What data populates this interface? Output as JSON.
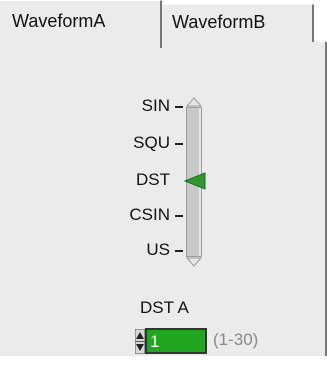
{
  "tabs": [
    {
      "label": "WaveformA",
      "active": true
    },
    {
      "label": "WaveformB",
      "active": false
    }
  ],
  "slider": {
    "labels": [
      "SIN",
      "SQU",
      "DST",
      "CSIN",
      "US"
    ],
    "selected": "DST",
    "pointer_color": "#2e9a2e"
  },
  "field": {
    "label": "DST A",
    "value": "1",
    "range": "(1-30)",
    "background_color": "#1fa51f"
  },
  "colors": {
    "panel_bg": "#ebebeb"
  }
}
